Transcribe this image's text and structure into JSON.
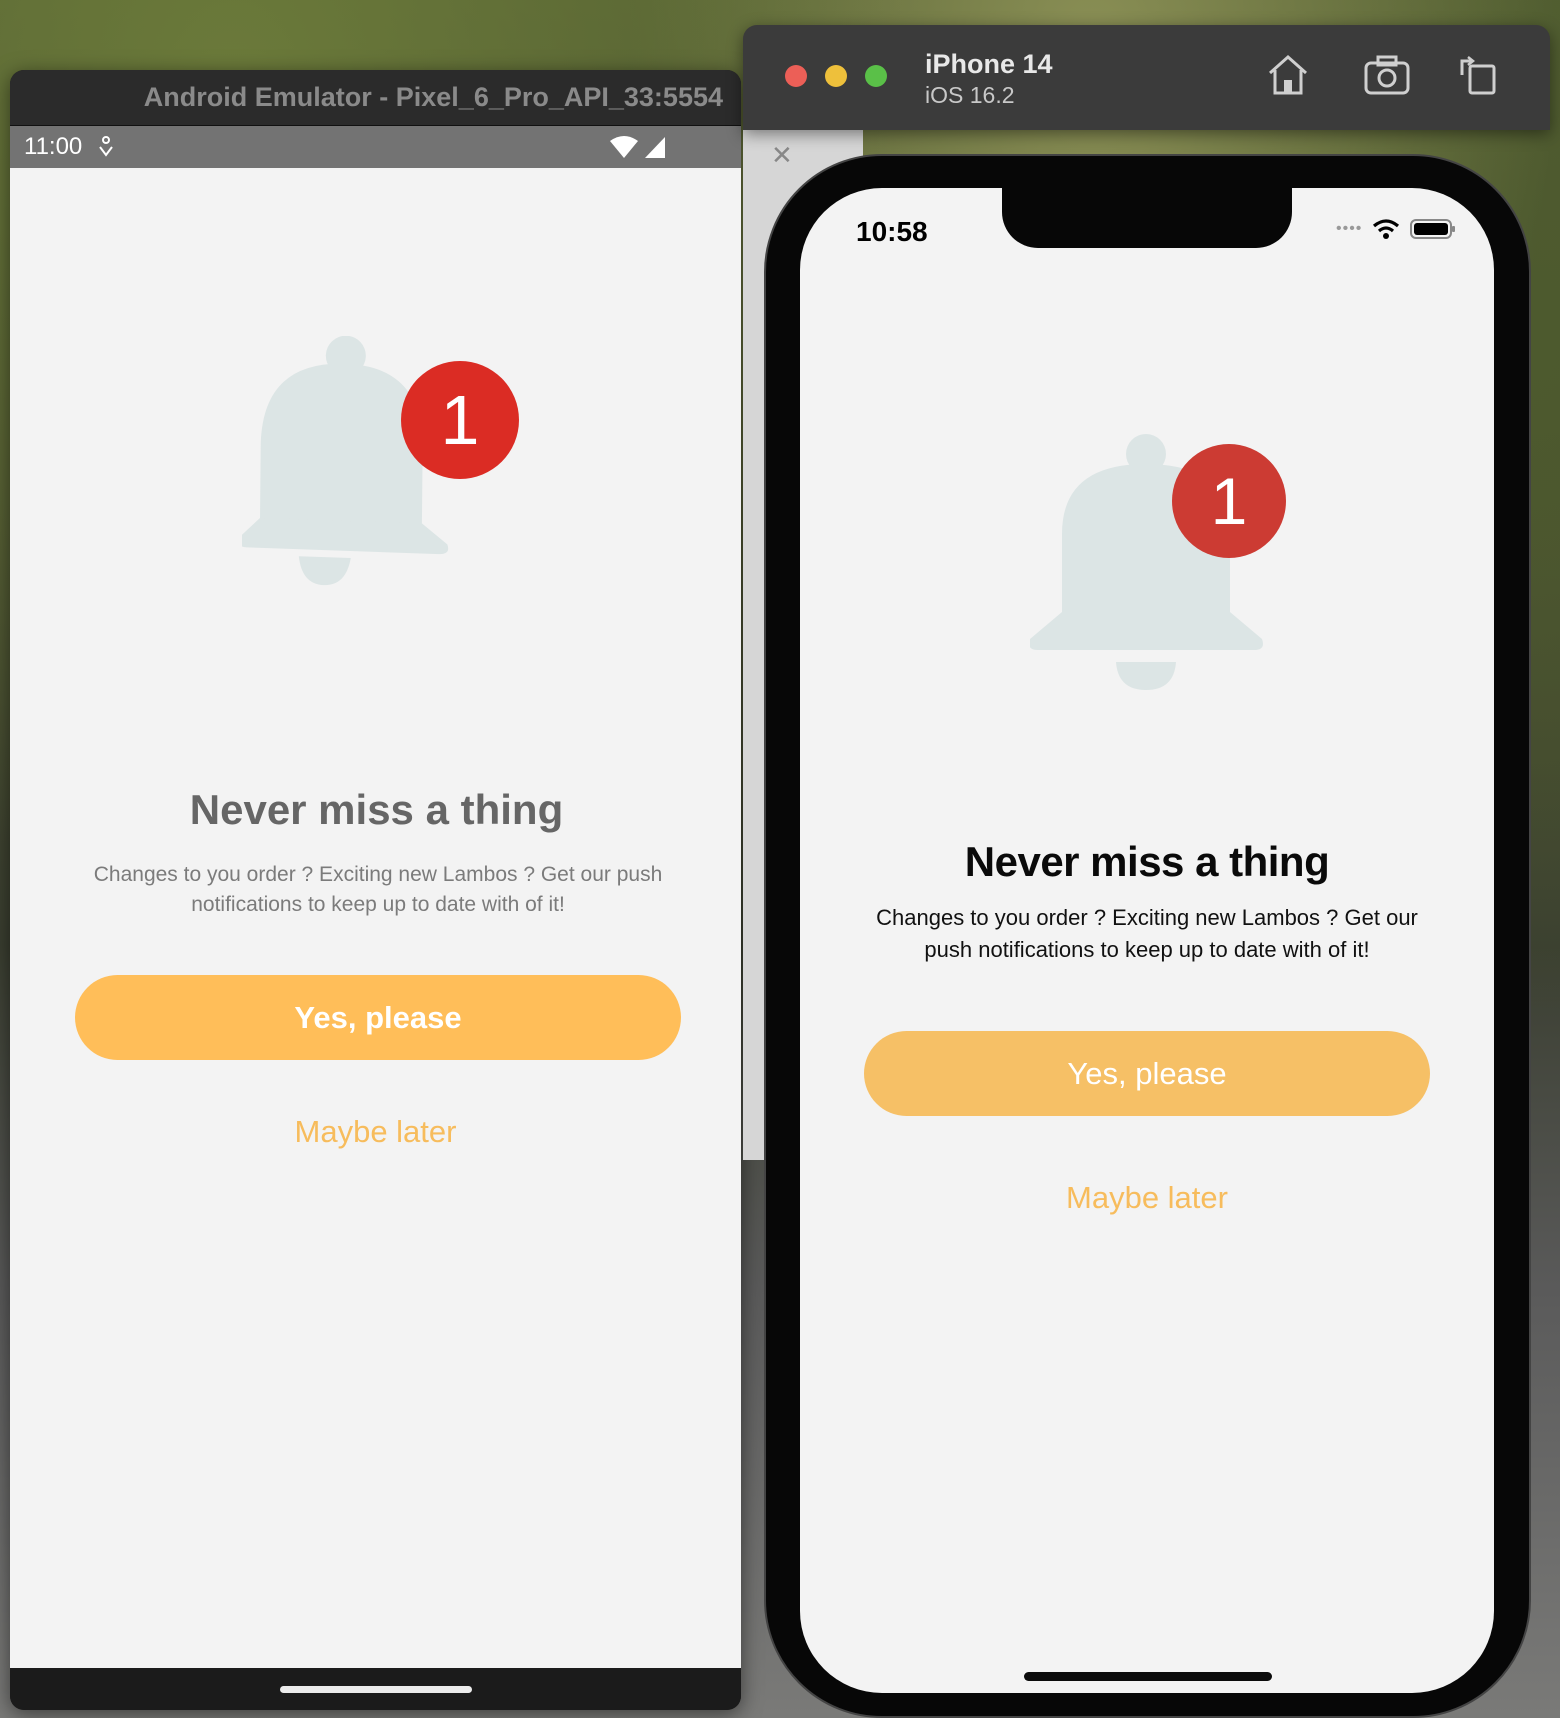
{
  "android": {
    "window_title": "Android Emulator - Pixel_6_Pro_API_33:5554",
    "status_time": "11:00",
    "badge_count": "1",
    "title": "Never miss a thing",
    "description": "Changes to you order ? Exciting new Lambos ? Get our push notifications to keep up to date with of it!",
    "primary_button": "Yes, please",
    "secondary_button": "Maybe later"
  },
  "ios": {
    "device_name": "iPhone 14",
    "os_version": "iOS 16.2",
    "status_time": "10:58",
    "badge_count": "1",
    "title": "Never miss a thing",
    "description": "Changes to you order ? Exciting new Lambos ? Get our push notifications to keep up to date with of it!",
    "primary_button": "Yes, please",
    "secondary_button": "Maybe later"
  },
  "colors": {
    "accent": "#ffbe59",
    "badge": "#db2c24",
    "bell": "#dce5e5",
    "screen_bg": "#f3f3f3"
  },
  "icons": [
    "home-icon",
    "screenshot-icon",
    "rotate-icon",
    "wifi-icon",
    "cell-signal-icon",
    "battery-icon",
    "bell-icon"
  ]
}
